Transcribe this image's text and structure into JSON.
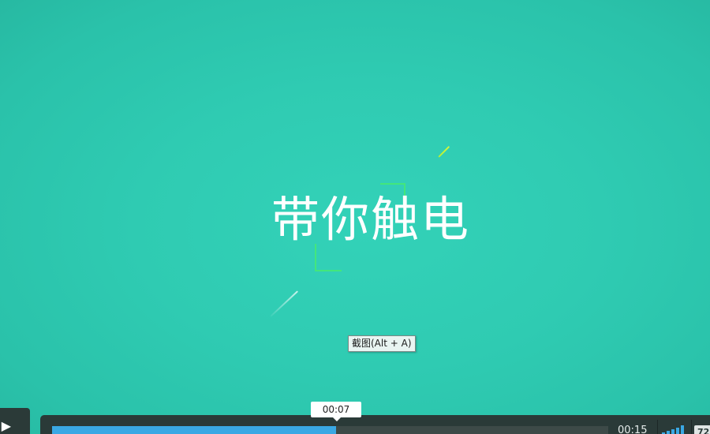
{
  "video": {
    "title_text": "带你触电"
  },
  "tooltip": {
    "text": "截图(Alt + A)"
  },
  "player": {
    "play_icon": "▶",
    "current_time": "00:07",
    "duration": "00:15",
    "progress_percent": 51,
    "volume_level": 1.0,
    "quality_label": "72"
  },
  "colors": {
    "background": "#2fcbb2",
    "accent_green": "#43e67c",
    "accent_yellow": "#d9f73a",
    "progress": "#3aa8e4",
    "controls_bg": "#2a3a38"
  }
}
